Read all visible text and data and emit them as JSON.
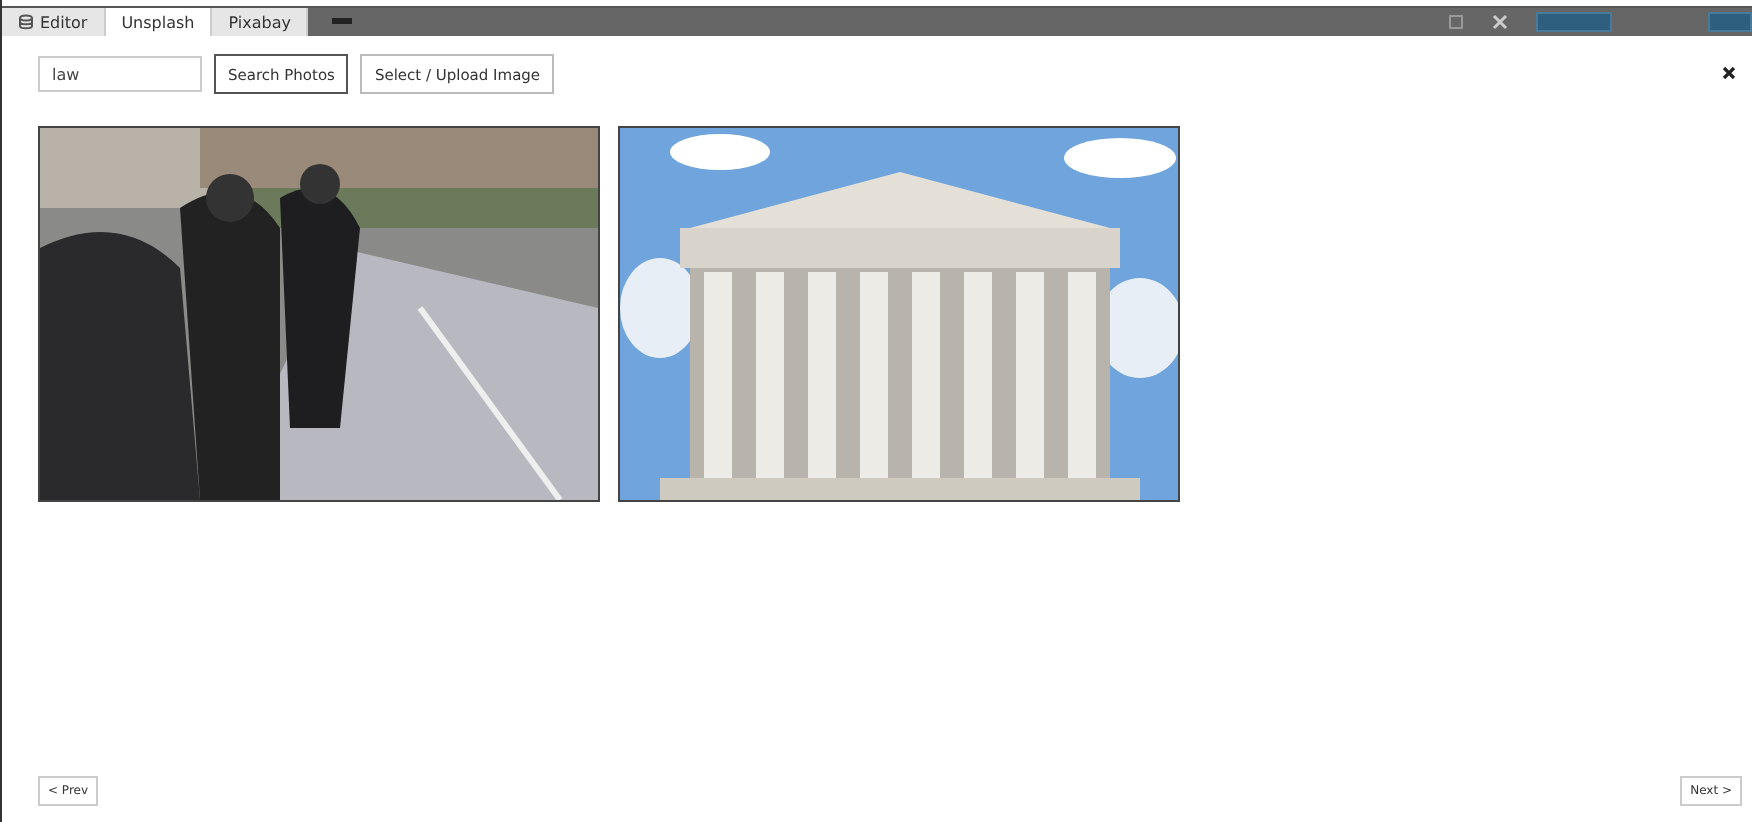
{
  "tabs": [
    {
      "label": "Editor",
      "selected": false,
      "kind": "icon"
    },
    {
      "label": "Unsplash",
      "selected": true,
      "kind": "plain"
    },
    {
      "label": "Pixabay",
      "selected": false,
      "kind": "plain"
    }
  ],
  "search": {
    "value": "law"
  },
  "buttons": [
    "Search Photos",
    "Select / Upload Image"
  ],
  "results": [
    {
      "kind": "picture"
    },
    {
      "kind": "picture"
    }
  ],
  "pager": {
    "prev": "< Prev",
    "next": "Next >"
  }
}
